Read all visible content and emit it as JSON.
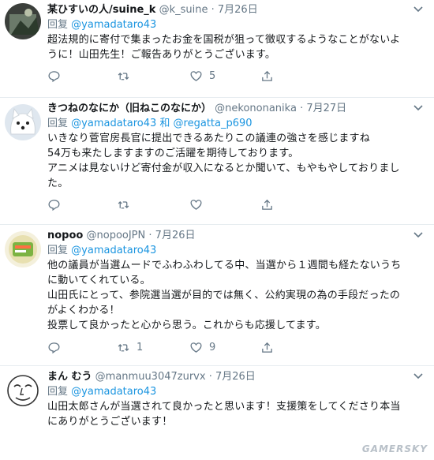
{
  "tweets": [
    {
      "name": "某ひすいの人/suine_k",
      "handle": "@k_suine",
      "sep": "·",
      "date": "7月26日",
      "reply_prefix": "回复",
      "mentions": "@yamadataro43",
      "lines": [
        "超法規的に寄付で集まったお金を国税が狙って徴収するようなことがないよ",
        "うに！山田先生！ご報告ありがとうございます。"
      ],
      "reply_count": "",
      "retweet_count": "",
      "like_count": "5"
    },
    {
      "name": "きつねのなにか（旧ねこのなにか）",
      "handle": "@nekononanika",
      "sep": "·",
      "date": "7月27日",
      "reply_prefix": "回复",
      "mentions": "@yamadataro43 和 @regatta_p690",
      "lines": [
        "いきなり菅官房長官に提出できるあたりこの議連の強さを感じますね",
        "54万も来たしますますのご活躍を期待しております。",
        "アニメは見ないけど寄付金が収入になるとか聞いて、もやもやしておりまし",
        "た。"
      ],
      "reply_count": "",
      "retweet_count": "",
      "like_count": ""
    },
    {
      "name": "nopoo",
      "handle": "@nopooJPN",
      "sep": "·",
      "date": "7月26日",
      "reply_prefix": "回复",
      "mentions": "@yamadataro43",
      "lines": [
        "他の議員が当選ムードでふわふわしてる中、当選から１週間も経たないうち",
        "に動いてくれている。",
        "山田氏にとって、参院選当選が目的では無く、公約実現の為の手段だったの",
        "がよくわかる！",
        "投票して良かったと心から思う。これからも応援してます。"
      ],
      "reply_count": "",
      "retweet_count": "1",
      "like_count": "9"
    },
    {
      "name": "まん むう",
      "handle": "@manmuu3047zurvx",
      "sep": "·",
      "date": "7月26日",
      "reply_prefix": "回复",
      "mentions": "@yamadataro43",
      "lines": [
        "山田太郎さんが当選されて良かったと思います！支援策をしてくださり本当",
        "にありがとうございます！"
      ],
      "reply_count": "",
      "retweet_count": "",
      "like_count": ""
    }
  ],
  "watermark": "GAMERSKY",
  "icons": {
    "reply": "reply-icon",
    "retweet": "retweet-icon",
    "like": "heart-icon",
    "share": "share-icon",
    "menu": "chevron-down-icon"
  },
  "colors": {
    "link": "#1b95e0",
    "muted": "#657786",
    "divider": "#e6ecf0"
  }
}
